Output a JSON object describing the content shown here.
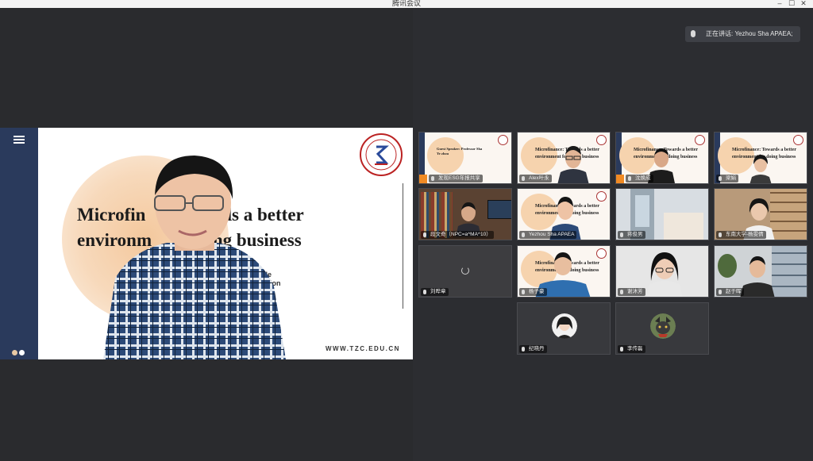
{
  "window": {
    "title": "腾讯会议",
    "minimize_icon": "minimize-icon",
    "maximize_icon": "maximize-icon",
    "close_icon": "close-icon"
  },
  "speaking_indicator": {
    "text": "正在讲话: Yezhou Sha APAEA;"
  },
  "shared_screen": {
    "slide_title_line1": "Microfin        owards a better",
    "slide_title_line2": "environm        doing business",
    "slide_subtitle_line1": "Trade",
    "slide_subtitle_line2": "ation",
    "slide_url": "WWW.TZC.EDU.CN",
    "menu_icon": "menu-icon"
  },
  "participants": [
    {
      "name": "发现ESG年报共享",
      "slide_text": "Guest Speaker: Professor Sha Ye zhou"
    },
    {
      "name": "Alex叶永",
      "slide_text": "Microfinance: Towards a better environment for doing business"
    },
    {
      "name": "沈焕成",
      "slide_text": "Microfinance: Towards a better environment for doing business"
    },
    {
      "name": "梁娟",
      "slide_text": "Microfinance: Towards a better environment for doing business"
    },
    {
      "name": "段文奇（NPC=a^MA^10）"
    },
    {
      "name": "Yezhou Sha APAEA",
      "slide_text": "Microfinance: Towards a better environment for doing business"
    },
    {
      "name": "蒋俊男"
    },
    {
      "name": "东南大学-杨雯倩"
    },
    {
      "name": "刘晔章"
    },
    {
      "name": "杨子豪",
      "slide_text": "Microfinance: Towards a better environment for doing business"
    },
    {
      "name": "谢沐芳"
    },
    {
      "name": "赵于晖"
    },
    {
      "name": "纪晓丹"
    },
    {
      "name": "李传磊"
    }
  ],
  "colors": {
    "sidebar_navy": "#2a3a5c",
    "host_orange": "#f08a24",
    "slide_peach": "#f4c89d"
  }
}
